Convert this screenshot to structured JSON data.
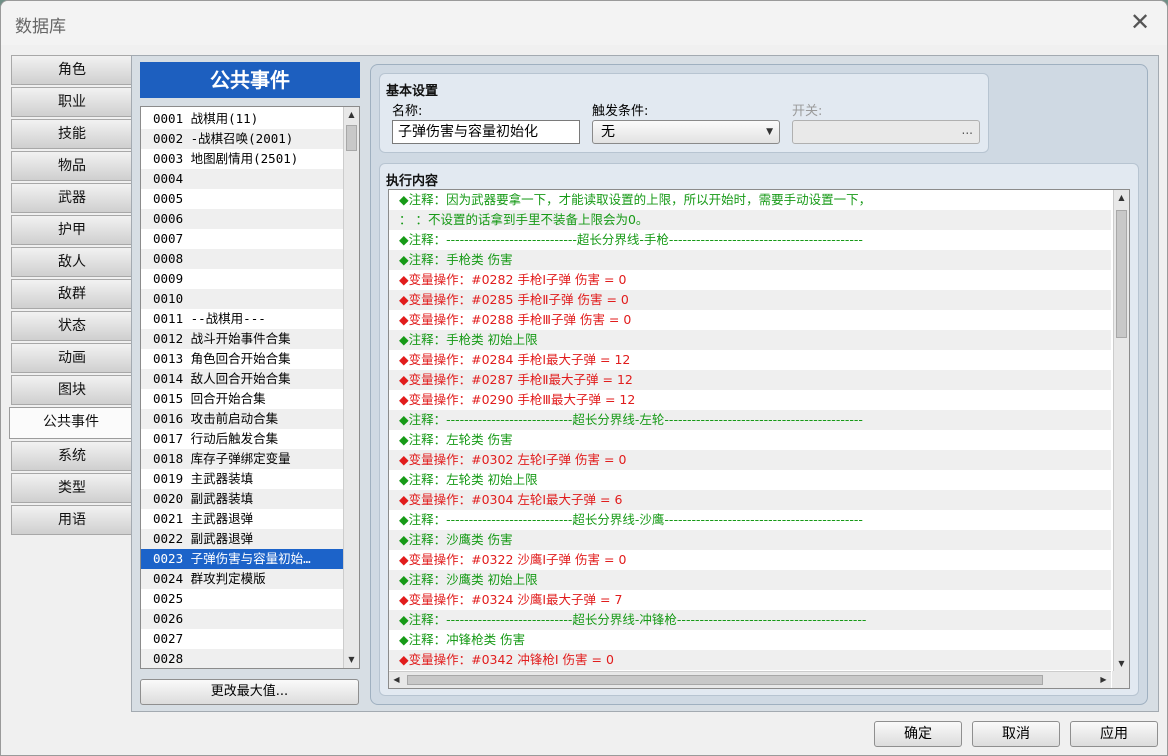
{
  "window": {
    "title": "数据库",
    "close_glyph": "✕"
  },
  "tabs": [
    "角色",
    "职业",
    "技能",
    "物品",
    "武器",
    "护甲",
    "敌人",
    "敌群",
    "状态",
    "动画",
    "图块",
    "公共事件",
    "系统",
    "类型",
    "用语"
  ],
  "active_tab": "公共事件",
  "common_events": {
    "header": "公共事件",
    "items": [
      "0001 战棋用(11)",
      "0002 -战棋召唤(2001)",
      "0003 地图剧情用(2501)",
      "0004",
      "0005",
      "0006",
      "0007",
      "0008",
      "0009",
      "0010",
      "0011 --战棋用---",
      "0012 战斗开始事件合集",
      "0013 角色回合开始合集",
      "0014 敌人回合开始合集",
      "0015 回合开始合集",
      "0016 攻击前启动合集",
      "0017 行动后触发合集",
      "0018 库存子弹绑定变量",
      "0019 主武器装填",
      "0020 副武器装填",
      "0021 主武器退弹",
      "0022 副武器退弹",
      "0023 子弹伤害与容量初始…",
      "0024 群攻判定模版",
      "0025",
      "0026",
      "0027",
      "0028"
    ],
    "selected_index": 22,
    "max_button": "更改最大值..."
  },
  "basic": {
    "title": "基本设置",
    "name_label": "名称:",
    "name_value": "子弹伤害与容量初始化",
    "trigger_label": "触发条件:",
    "trigger_value": "无",
    "switch_label": "开关:",
    "switch_button": "..."
  },
  "exec": {
    "title": "执行内容",
    "commands": [
      {
        "kind": "c",
        "text": "◆注释：因为武器要拿一下，才能读取设置的上限，所以开始时，需要手动设置一下，"
      },
      {
        "kind": "c",
        "text": "：    ：不设置的话拿到手里不装备上限会为0。"
      },
      {
        "kind": "c",
        "text": "◆注释：-----------------------------超长分界线-手枪-------------------------------------------"
      },
      {
        "kind": "c",
        "text": "◆注释：手枪类 伤害"
      },
      {
        "kind": "v",
        "text": "◆变量操作：#0282 手枪Ⅰ子弹 伤害 = 0"
      },
      {
        "kind": "v",
        "text": "◆变量操作：#0285 手枪Ⅱ子弹 伤害 = 0"
      },
      {
        "kind": "v",
        "text": "◆变量操作：#0288 手枪Ⅲ子弹 伤害 = 0"
      },
      {
        "kind": "c",
        "text": "◆注释：手枪类 初始上限"
      },
      {
        "kind": "v",
        "text": "◆变量操作：#0284 手枪Ⅰ最大子弹 = 12"
      },
      {
        "kind": "v",
        "text": "◆变量操作：#0287 手枪Ⅱ最大子弹 = 12"
      },
      {
        "kind": "v",
        "text": "◆变量操作：#0290 手枪Ⅲ最大子弹 = 12"
      },
      {
        "kind": "c",
        "text": "◆注释：----------------------------超长分界线-左轮--------------------------------------------"
      },
      {
        "kind": "c",
        "text": "◆注释：左轮类 伤害"
      },
      {
        "kind": "v",
        "text": "◆变量操作：#0302 左轮Ⅰ子弹 伤害 = 0"
      },
      {
        "kind": "c",
        "text": "◆注释：左轮类 初始上限"
      },
      {
        "kind": "v",
        "text": "◆变量操作：#0304 左轮Ⅰ最大子弹 = 6"
      },
      {
        "kind": "c",
        "text": "◆注释：----------------------------超长分界线-沙鹰--------------------------------------------"
      },
      {
        "kind": "c",
        "text": "◆注释：沙鹰类 伤害"
      },
      {
        "kind": "v",
        "text": "◆变量操作：#0322 沙鹰Ⅰ子弹 伤害 = 0"
      },
      {
        "kind": "c",
        "text": "◆注释：沙鹰类 初始上限"
      },
      {
        "kind": "v",
        "text": "◆变量操作：#0324 沙鹰Ⅰ最大子弹 = 7"
      },
      {
        "kind": "c",
        "text": "◆注释：----------------------------超长分界线-冲锋枪------------------------------------------"
      },
      {
        "kind": "c",
        "text": "◆注释：冲锋枪类 伤害"
      },
      {
        "kind": "v",
        "text": "◆变量操作：#0342 冲锋枪Ⅰ 伤害 = 0"
      }
    ]
  },
  "buttons": {
    "ok": "确定",
    "cancel": "取消",
    "apply": "应用"
  },
  "colors": {
    "comment": "#179a17",
    "variable": "#e11c1c",
    "selection": "#1c63c9",
    "header": "#1d5fbf"
  }
}
